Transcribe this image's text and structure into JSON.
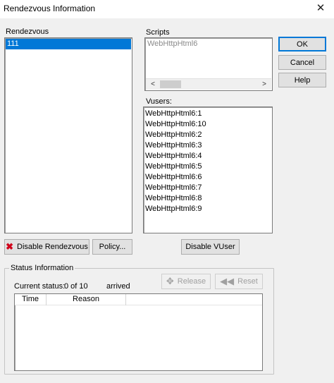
{
  "window": {
    "title": "Rendezvous Information",
    "close_glyph": "✕"
  },
  "rendezvous": {
    "label": "Rendezvous",
    "items": [
      {
        "text": "111",
        "selected": true
      }
    ]
  },
  "scripts": {
    "label": "Scripts",
    "items": [
      "WebHttpHtml6"
    ],
    "scroll_left": "<",
    "scroll_right": ">"
  },
  "vusers": {
    "label": "Vusers:",
    "items": [
      "WebHttpHtml6:1",
      "WebHttpHtml6:10",
      "WebHttpHtml6:2",
      "WebHttpHtml6:3",
      "WebHttpHtml6:4",
      "WebHttpHtml6:5",
      "WebHttpHtml6:6",
      "WebHttpHtml6:7",
      "WebHttpHtml6:8",
      "WebHttpHtml6:9"
    ]
  },
  "buttons": {
    "ok": "OK",
    "cancel": "Cancel",
    "help": "Help",
    "disable_rendezvous": "Disable Rendezvous",
    "policy": "Policy...",
    "disable_vuser": "Disable VUser",
    "release": "Release",
    "reset": "Reset"
  },
  "icons": {
    "disable_rendezvous": "red-x-icon",
    "release": "move-arrows-icon",
    "reset": "rewind-icon"
  },
  "status": {
    "group_title": "Status Information",
    "current_label": "Current status:",
    "current_value": "0 of 10",
    "arrived": "arrived",
    "columns": [
      "Time",
      "Reason"
    ]
  },
  "colors": {
    "selection": "#0078d7",
    "disable_icon": "#d0021b",
    "disabled_text": "#a0a0a0"
  }
}
